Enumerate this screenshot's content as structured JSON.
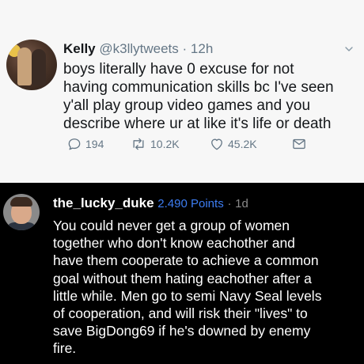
{
  "tweet": {
    "display_name": "Kelly",
    "handle": "@k3llytweets",
    "separator": "·",
    "time": "12h",
    "body_lines": [
      "boys literally have 0 excuse for not",
      "having communication skills bc I've seen",
      "y'all play group video games and you",
      "describe where ur at like it's life or death"
    ],
    "actions": {
      "replies": "194",
      "retweets": "10.2K",
      "likes": "45.2K"
    },
    "icons": [
      "avatar",
      "chevron-down-icon",
      "reply-icon",
      "retweet-icon",
      "heart-icon",
      "direct-message-icon"
    ]
  },
  "comment": {
    "username": "the_lucky_duke",
    "points": "2.490 Points",
    "separator": "·",
    "age": "1d",
    "body_lines": [
      "You could never get a group of women",
      "together who don't know eachother and",
      "have them cooperate to achieve a common",
      "goal without them hating eachother after a",
      "little while. Men go to semi Navy Seal levels",
      "of cooperation, and will risk their \"lives\" to",
      "save BigDong69 if he's downed by enemy",
      "fire."
    ],
    "colors": {
      "background": "#000000",
      "points": "#3d7df2"
    }
  }
}
